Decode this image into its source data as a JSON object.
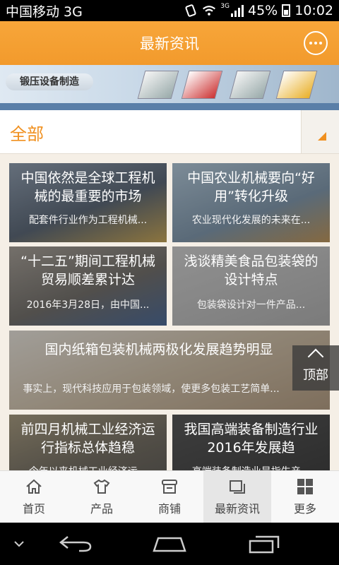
{
  "status_bar": {
    "carrier": "中国移动 3G",
    "network": "3G",
    "battery": "45%",
    "time": "10:02"
  },
  "header": {
    "title": "最新资讯",
    "message_icon": "chat-bubble-icon"
  },
  "banner": {
    "text": "锻压设备制造"
  },
  "category": {
    "selected": "全部"
  },
  "articles": [
    {
      "title": "中国依然是全球工程机械的最重要的市场",
      "summary": "配套件行业作为工程机械..."
    },
    {
      "title": "中国农业机械要向“好用”转化升级",
      "summary": "农业现代化发展的未来在..."
    },
    {
      "title": "“十二五”期间工程机械贸易顺差累计达",
      "summary": "2016年3月28日，由中国..."
    },
    {
      "title": "浅谈精美食品包装袋的设计特点",
      "summary": "包装袋设计对一件产品..."
    },
    {
      "title": "国内纸箱包装机械两极化发展趋势明显",
      "summary": "事实上，现代科技应用于包装领域，使更多包装工艺简单..."
    },
    {
      "title": "前四月机械工业经济运行指标总体趋稳",
      "summary": "今年以来机械工业经济运..."
    },
    {
      "title": "我国高端装备制造行业2016年发展趋",
      "summary": "高端装备制造业是指生产..."
    }
  ],
  "back_to_top": {
    "label": "顶部"
  },
  "tabs": [
    {
      "label": "首页",
      "icon": "home-icon"
    },
    {
      "label": "产品",
      "icon": "shirt-icon"
    },
    {
      "label": "商铺",
      "icon": "shop-icon"
    },
    {
      "label": "最新资讯",
      "icon": "news-icon",
      "active": true
    },
    {
      "label": "更多",
      "icon": "grid-icon"
    }
  ],
  "colors": {
    "accent": "#f29a2c",
    "category_text": "#f0901f"
  }
}
